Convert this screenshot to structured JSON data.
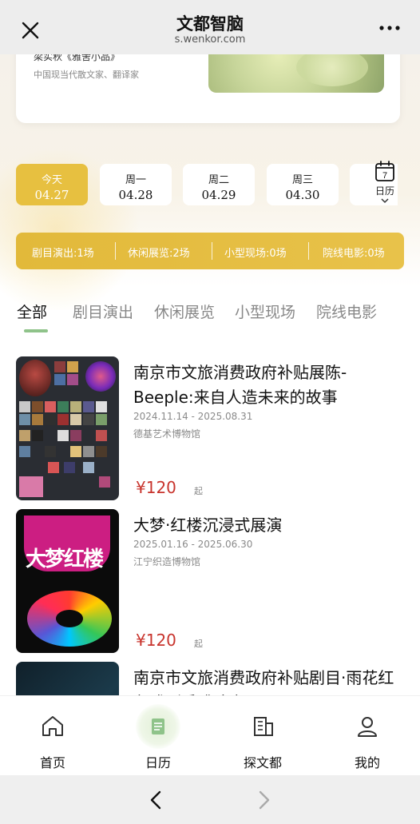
{
  "topbar": {
    "title": "文都智脑",
    "subtitle": "s.wenkor.com",
    "close_icon": "close-icon",
    "more_icon": "more-icon"
  },
  "quote": {
    "author": "梁实秋《雅舍小品》",
    "description": "中国现当代散文家、翻译家"
  },
  "dates": [
    {
      "weekday": "今天",
      "date": "04.27",
      "active": true
    },
    {
      "weekday": "周一",
      "date": "04.28",
      "active": false
    },
    {
      "weekday": "周二",
      "date": "04.29",
      "active": false
    },
    {
      "weekday": "周三",
      "date": "04.30",
      "active": false
    }
  ],
  "calendar": {
    "day": "7",
    "label": "日历"
  },
  "stats": [
    "剧目演出:1场",
    "休闲展览:2场",
    "小型现场:0场",
    "院线电影:0场"
  ],
  "tabs": [
    "全部",
    "剧目演出",
    "休闲展览",
    "小型现场",
    "院线电影"
  ],
  "events": [
    {
      "title": "南京市文旅消费政府补贴展陈-Beeple:来自人造未来的故事",
      "date": "2024.11.14 - 2025.08.31",
      "venue": "德基艺术博物馆",
      "price": "¥120",
      "price_suffix": "起"
    },
    {
      "title": "大梦·红楼沉浸式展演",
      "date": "2025.01.16 - 2025.06.30",
      "venue": "江宁织造博物馆",
      "price": "¥120",
      "price_suffix": "起",
      "poster_text": "大梦红楼"
    },
    {
      "title": "南京市文旅消费政府补贴剧目·雨花红色戏剧季·《时琼一……",
      "date": "",
      "venue": ""
    }
  ],
  "bottom_nav": [
    {
      "label": "首页",
      "icon": "home-icon"
    },
    {
      "label": "日历",
      "icon": "calendar-icon"
    },
    {
      "label": "探文都",
      "icon": "building-icon"
    },
    {
      "label": "我的",
      "icon": "user-icon"
    }
  ],
  "colors": {
    "accent": "#e7c040",
    "price": "#c8342d",
    "tab_indicator": "#8fc38a"
  }
}
